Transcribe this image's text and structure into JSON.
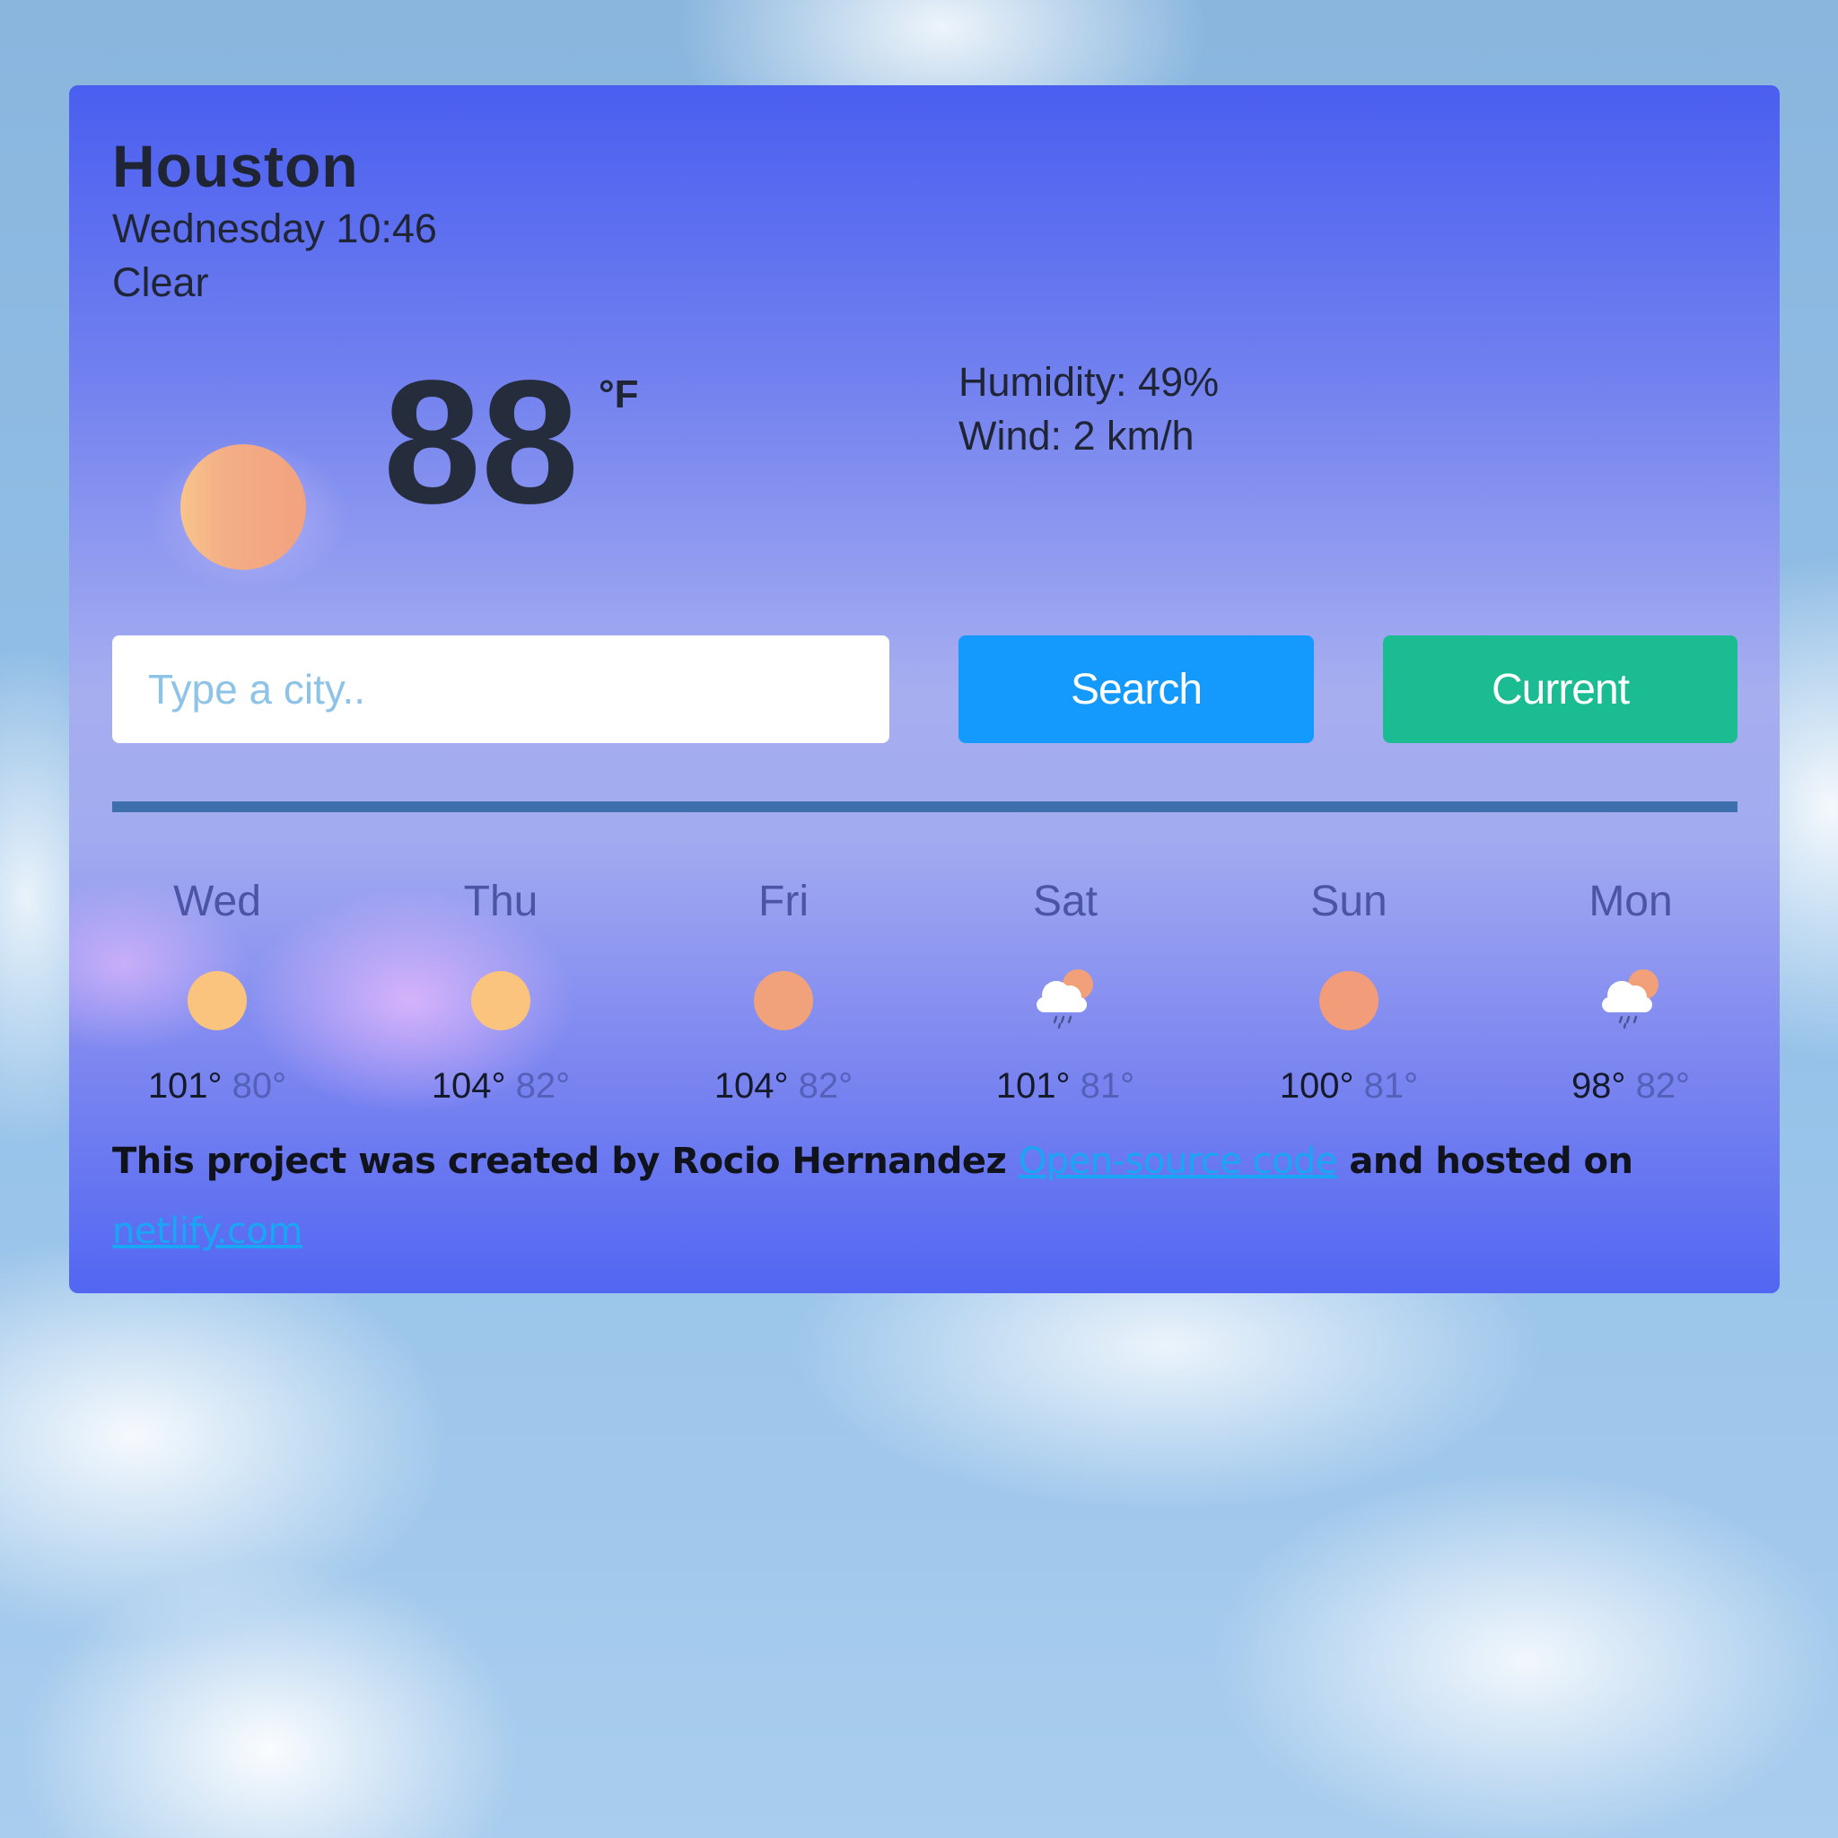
{
  "weather": {
    "city": "Houston",
    "datetime": "Wednesday 10:46",
    "description": "Clear",
    "icon": "sun-icon",
    "temperature": "88",
    "unit": "°F",
    "humidity_label": "Humidity: 49%",
    "wind_label": "Wind: 2 km/h"
  },
  "search": {
    "placeholder": "Type a city..",
    "value": "",
    "search_label": "Search",
    "current_label": "Current"
  },
  "colors": {
    "search_button": "#139afc",
    "current_button": "#1bbc92",
    "divider": "#3e6fad",
    "link": "#19a6f5"
  },
  "forecast": [
    {
      "day": "Wed",
      "icon": "sun-icon",
      "max": "101°",
      "min": "80°"
    },
    {
      "day": "Thu",
      "icon": "sun-icon",
      "max": "104°",
      "min": "82°"
    },
    {
      "day": "Fri",
      "icon": "sun-icon",
      "max": "104°",
      "min": "82°"
    },
    {
      "day": "Sat",
      "icon": "cloud-sun-rain-icon",
      "max": "101°",
      "min": "81°"
    },
    {
      "day": "Sun",
      "icon": "sun-icon",
      "max": "100°",
      "min": "81°"
    },
    {
      "day": "Mon",
      "icon": "cloud-sun-rain-icon",
      "max": "98°",
      "min": "82°"
    }
  ],
  "footer": {
    "text_before": "This project was created by Rocio Hernandez ",
    "link1": "Open-source code",
    "text_middle": " and hosted on ",
    "link2": "netlify.com"
  }
}
